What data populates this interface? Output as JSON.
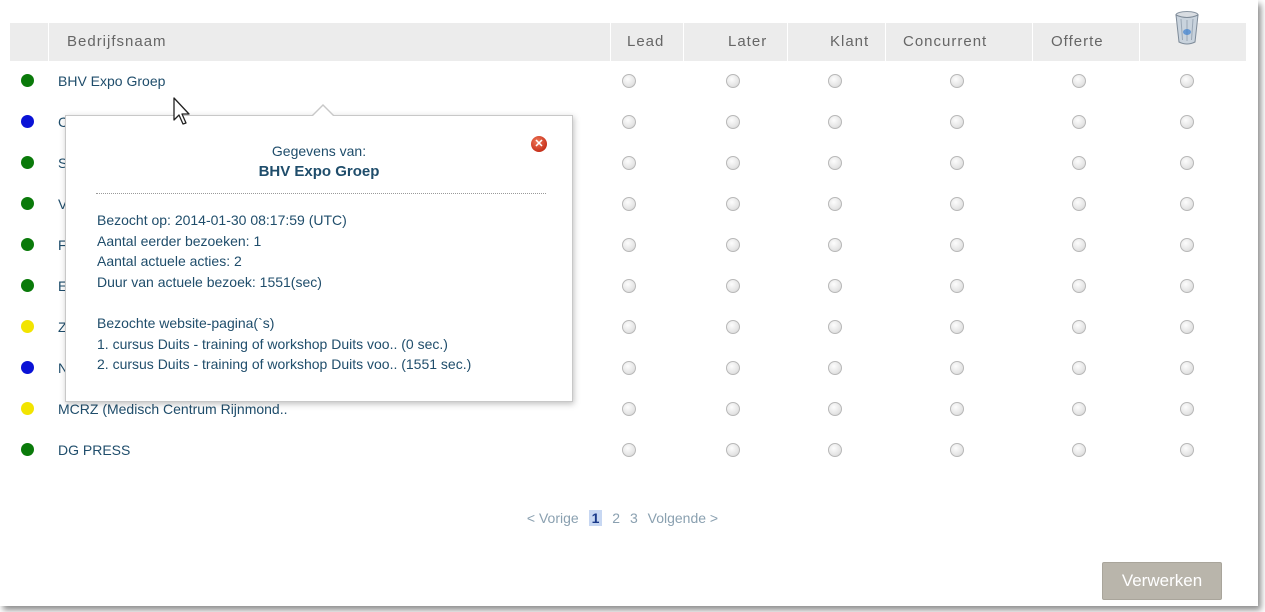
{
  "header": {
    "company_col": "Bedrijfsnaam",
    "columns": [
      "Lead",
      "Later",
      "Klant",
      "Concurrent",
      "Offerte"
    ],
    "delete_icon": "trash-icon"
  },
  "rows": [
    {
      "name": "BHV Expo Groep",
      "status_color": "#0a7a0a"
    },
    {
      "name": "C",
      "status_color": "#0a12d6"
    },
    {
      "name": "S",
      "status_color": "#0a7a0a"
    },
    {
      "name": "V",
      "status_color": "#0a7a0a"
    },
    {
      "name": "F",
      "status_color": "#0a7a0a"
    },
    {
      "name": "E",
      "status_color": "#0a7a0a"
    },
    {
      "name": "Z",
      "status_color": "#f2e400"
    },
    {
      "name": "N",
      "status_color": "#0a12d6"
    },
    {
      "name": "MCRZ (Medisch Centrum Rijnmond..",
      "status_color": "#f2e400"
    },
    {
      "name": "DG PRESS",
      "status_color": "#0a7a0a"
    }
  ],
  "popup": {
    "title": "Gegevens van:",
    "company": "BHV Expo Groep",
    "visited": "Bezocht op: 2014-01-30 08:17:59 (UTC)",
    "prev_visits": "Aantal eerder bezoeken: 1",
    "actions": "Aantal actuele acties: 2",
    "duration": "Duur van actuele bezoek: 1551(sec)",
    "pages_title": "Bezochte website-pagina(`s)",
    "pages": [
      "1. cursus Duits - training of workshop Duits voo.. (0 sec.)",
      "2. cursus Duits - training of workshop Duits voo.. (1551 sec.)"
    ],
    "close_icon": "close-icon"
  },
  "pagination": {
    "prev": "< Vorige",
    "pages": [
      "1",
      "2",
      "3"
    ],
    "current": "1",
    "next": "Volgende >"
  },
  "process_button": "Verwerken"
}
